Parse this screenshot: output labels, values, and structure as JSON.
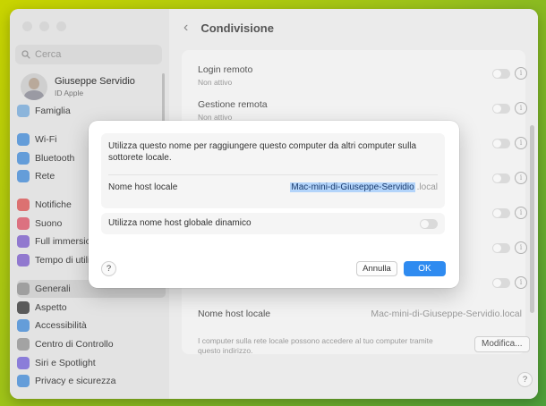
{
  "search": {
    "placeholder": "Cerca"
  },
  "user": {
    "name": "Giuseppe Servidio",
    "subtitle": "ID Apple"
  },
  "sidebar": {
    "items": [
      {
        "label": "Famiglia",
        "color": "#6fa6d8"
      },
      {
        "label": "Wi-Fi",
        "color": "#3a86d6"
      },
      {
        "label": "Bluetooth",
        "color": "#3a86d6"
      },
      {
        "label": "Rete",
        "color": "#3a86d6"
      },
      {
        "label": "Notifiche",
        "color": "#d94b4b"
      },
      {
        "label": "Suono",
        "color": "#d94b5f"
      },
      {
        "label": "Full immersio",
        "color": "#7656c8"
      },
      {
        "label": "Tempo di utili",
        "color": "#7656c8"
      },
      {
        "label": "Generali",
        "color": "#8e8e8e"
      },
      {
        "label": "Aspetto",
        "color": "#2c2c2c"
      },
      {
        "label": "Accessibilità",
        "color": "#3a86d6"
      },
      {
        "label": "Centro di Controllo",
        "color": "#8e8e8e"
      },
      {
        "label": "Siri e Spotlight",
        "color": "#6e5bd6"
      },
      {
        "label": "Privacy e sicurezza",
        "color": "#3a86d6"
      }
    ]
  },
  "header": {
    "title": "Condivisione"
  },
  "main": {
    "rows": [
      {
        "title": "Login remoto",
        "status": "Non attivo"
      },
      {
        "title": "Gestione remota",
        "status": "Non attivo"
      }
    ],
    "host_label": "Nome host locale",
    "host_value": "Mac-mini-di-Giuseppe-Servidio.local",
    "note": "I computer sulla rete locale possono accedere al tuo computer tramite questo indirizzo.",
    "modify_button": "Modifica...",
    "help": "?"
  },
  "dialog": {
    "description": "Utilizza questo nome per raggiungere questo computer da altri computer sulla sottorete locale.",
    "host_label": "Nome host locale",
    "host_value_selected": "Mac-mini-di-Giuseppe-Servidio",
    "host_suffix": ".local",
    "dynamic_label": "Utilizza nome host globale dinamico",
    "dynamic_enabled": false,
    "help": "?",
    "cancel": "Annulla",
    "ok": "OK",
    "accent": "#2f8bf0"
  }
}
